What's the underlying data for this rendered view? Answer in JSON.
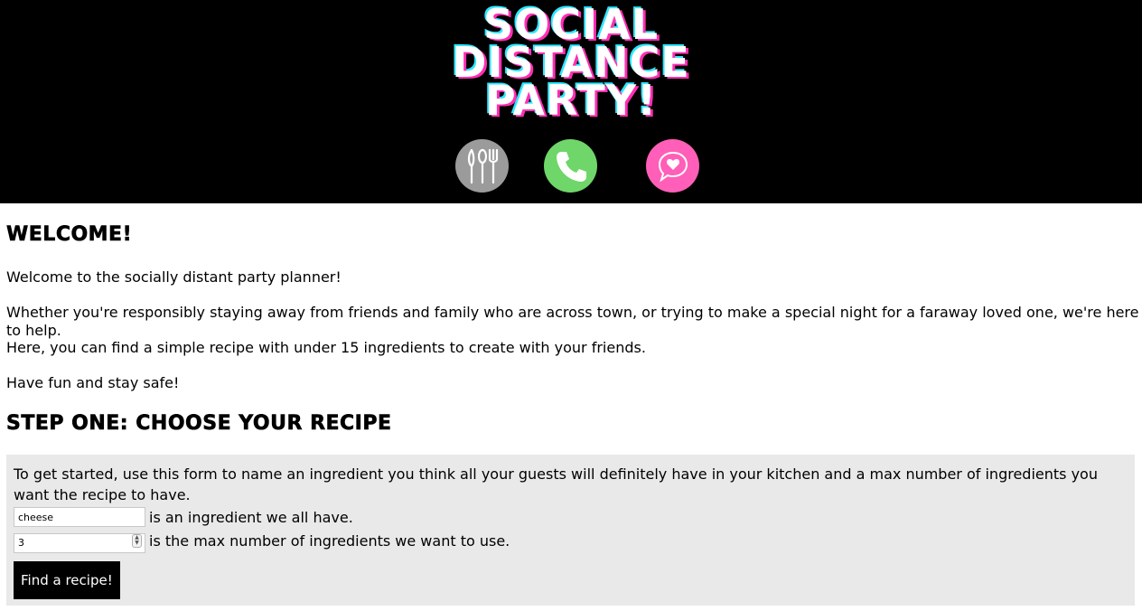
{
  "header": {
    "logo_lines": [
      "SOCIAL",
      "DISTANCE",
      "PARTY!"
    ],
    "icons": [
      {
        "name": "utensils-icon",
        "color": "#9b9b9b"
      },
      {
        "name": "phone-icon",
        "color": "#6fd66a"
      },
      {
        "name": "heart-chat-icon",
        "color": "#ff5fb8"
      }
    ]
  },
  "welcome": {
    "heading": "Welcome!",
    "paragraphs": [
      "Welcome to the socially distant party planner!",
      "Whether you're responsibly staying away from friends and family who are across town, or trying to make a special night for a faraway loved one, we're here to help.",
      "Here, you can find a simple recipe with under 15 ingredients to create with your friends.",
      "Have fun and stay safe!"
    ]
  },
  "step_one": {
    "heading": "Step One: Choose Your Recipe",
    "intro": "To get started, use this form to name an ingredient you think all your guests will definitely have in your kitchen and a max number of ingredients you want the recipe to have.",
    "ingredient_value": "cheese",
    "ingredient_suffix": "is an ingredient we all have.",
    "max_value": "3",
    "max_suffix": "is the max number of ingredients we want to use.",
    "submit_label": "Find a recipe!"
  }
}
